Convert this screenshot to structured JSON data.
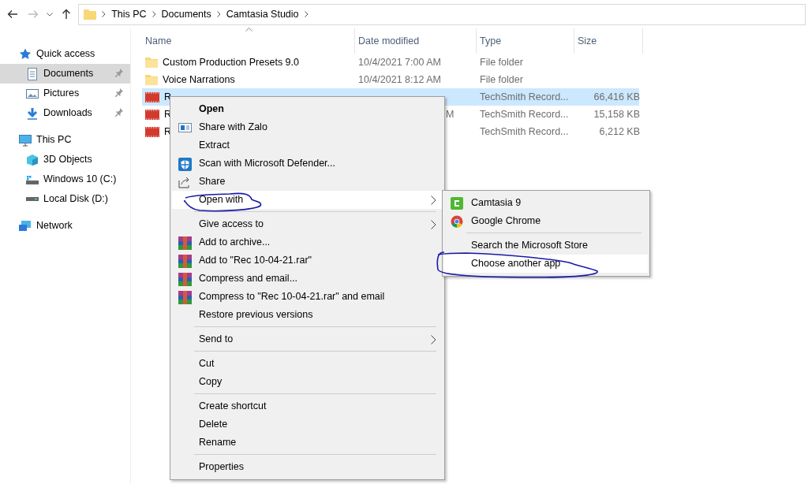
{
  "toolbar": {
    "address": [
      "This PC",
      "Documents",
      "Camtasia Studio"
    ]
  },
  "sidebar": {
    "items": [
      {
        "label": "Quick access",
        "kind": "star",
        "selected": false,
        "children": [
          {
            "label": "Documents",
            "kind": "document",
            "pinned": true,
            "selected": true
          },
          {
            "label": "Pictures",
            "kind": "picture",
            "pinned": true,
            "selected": false
          },
          {
            "label": "Downloads",
            "kind": "download",
            "pinned": true,
            "selected": false
          }
        ]
      },
      {
        "label": "This PC",
        "kind": "computer",
        "selected": false,
        "children": [
          {
            "label": "3D Objects",
            "kind": "cube",
            "pinned": false,
            "selected": false
          },
          {
            "label": "Windows 10 (C:)",
            "kind": "sysdrive",
            "pinned": false,
            "selected": false
          },
          {
            "label": "Local Disk (D:)",
            "kind": "drive",
            "pinned": false,
            "selected": false
          }
        ]
      },
      {
        "label": "Network",
        "kind": "network",
        "selected": false
      }
    ]
  },
  "table": {
    "columns": [
      "Name",
      "Date modified",
      "Type",
      "Size"
    ],
    "rows": [
      {
        "kind": "folder",
        "name": "Custom Production Presets 9.0",
        "date_modified": "10/4/2021 7:00 AM",
        "type": "File folder",
        "selected": false
      },
      {
        "kind": "folder",
        "name": "Voice Narrations",
        "date_modified": "10/4/2021 8:12 AM",
        "type": "File folder",
        "selected": false
      },
      {
        "kind": "recording",
        "name": "R",
        "type": "TechSmith Record...",
        "size": "66,416 KB",
        "selected": true
      },
      {
        "kind": "recording",
        "name": "R",
        "date_modified": "M",
        "type": "TechSmith Record...",
        "size": "15,158 KB",
        "selected": false
      },
      {
        "kind": "recording",
        "name": "R",
        "type": "TechSmith Record...",
        "size": "6,212 KB",
        "selected": false
      }
    ]
  },
  "context_menu": {
    "groups": [
      [
        {
          "label": "Open",
          "kind": "plain",
          "bold": true,
          "submenu": false,
          "highlighted": false
        },
        {
          "label": "Share with Zalo",
          "kind": "zalo",
          "bold": false,
          "submenu": false,
          "highlighted": false
        },
        {
          "label": "Extract",
          "kind": "plain",
          "bold": false,
          "submenu": false,
          "highlighted": false
        },
        {
          "label": "Scan with Microsoft Defender...",
          "kind": "shield",
          "bold": false,
          "submenu": false,
          "highlighted": false
        },
        {
          "label": "Share",
          "kind": "share",
          "bold": false,
          "submenu": false,
          "highlighted": false
        },
        {
          "label": "Open with",
          "kind": "plain",
          "bold": false,
          "submenu": true,
          "highlighted": true
        }
      ],
      [
        {
          "label": "Give access to",
          "kind": "plain",
          "bold": false,
          "submenu": true,
          "highlighted": false
        },
        {
          "label": "Add to archive...",
          "kind": "archive",
          "bold": false,
          "submenu": false,
          "highlighted": false
        },
        {
          "label": "Add to \"Rec 10-04-21.rar\"",
          "kind": "archive",
          "bold": false,
          "submenu": false,
          "highlighted": false
        },
        {
          "label": "Compress and email...",
          "kind": "archive",
          "bold": false,
          "submenu": false,
          "highlighted": false
        },
        {
          "label": "Compress to \"Rec 10-04-21.rar\" and email",
          "kind": "archive",
          "bold": false,
          "submenu": false,
          "highlighted": false
        },
        {
          "label": "Restore previous versions",
          "kind": "plain",
          "bold": false,
          "submenu": false,
          "highlighted": false
        }
      ],
      [
        {
          "label": "Send to",
          "kind": "plain",
          "bold": false,
          "submenu": true,
          "highlighted": false
        }
      ],
      [
        {
          "label": "Cut",
          "kind": "plain",
          "bold": false,
          "submenu": false,
          "highlighted": false
        },
        {
          "label": "Copy",
          "kind": "plain",
          "bold": false,
          "submenu": false,
          "highlighted": false
        }
      ],
      [
        {
          "label": "Create shortcut",
          "kind": "plain",
          "bold": false,
          "submenu": false,
          "highlighted": false
        },
        {
          "label": "Delete",
          "kind": "plain",
          "bold": false,
          "submenu": false,
          "highlighted": false
        },
        {
          "label": "Rename",
          "kind": "plain",
          "bold": false,
          "submenu": false,
          "highlighted": false
        }
      ],
      [
        {
          "label": "Properties",
          "kind": "plain",
          "bold": false,
          "submenu": false,
          "highlighted": false
        }
      ]
    ]
  },
  "open_with_menu": {
    "groups": [
      [
        {
          "label": "Camtasia 9",
          "kind": "camtasia",
          "highlighted": false
        },
        {
          "label": "Google Chrome",
          "kind": "chrome",
          "highlighted": false
        }
      ],
      [
        {
          "label": "Search the Microsoft Store",
          "kind": "plain",
          "highlighted": false
        },
        {
          "label": "Choose another app",
          "kind": "plain",
          "highlighted": true
        }
      ]
    ]
  }
}
